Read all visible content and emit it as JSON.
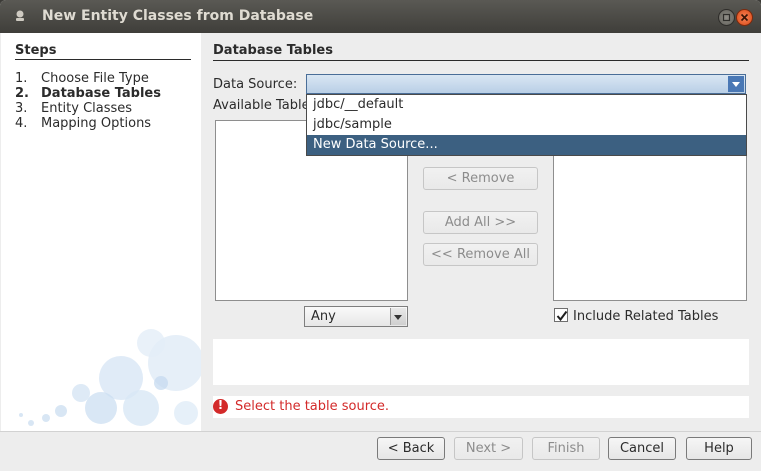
{
  "window": {
    "title": "New Entity Classes from Database"
  },
  "steps": {
    "title": "Steps",
    "items": [
      {
        "num": "1.",
        "label": "Choose File Type"
      },
      {
        "num": "2.",
        "label": "Database Tables"
      },
      {
        "num": "3.",
        "label": "Entity Classes"
      },
      {
        "num": "4.",
        "label": "Mapping Options"
      }
    ]
  },
  "main": {
    "section_title": "Database Tables",
    "data_source_label": "Data Source:",
    "available_tables_label": "Available Tables:",
    "data_source_value": "",
    "dropdown_options": [
      "jdbc/__default",
      "jdbc/sample",
      "New Data Source..."
    ],
    "dropdown_selected_index": 2,
    "remove_button": "< Remove",
    "add_all_button": "Add All >>",
    "remove_all_button": "<< Remove All",
    "filter_value": "Any",
    "include_related_label": "Include Related Tables",
    "include_related_checked": true,
    "error_text": "Select the table source."
  },
  "footer": {
    "back": "< Back",
    "next": "Next >",
    "finish": "Finish",
    "cancel": "Cancel",
    "help": "Help"
  },
  "colors": {
    "selection": "#3c6081",
    "error": "#d32a2a",
    "close_button": "#dd4814"
  }
}
